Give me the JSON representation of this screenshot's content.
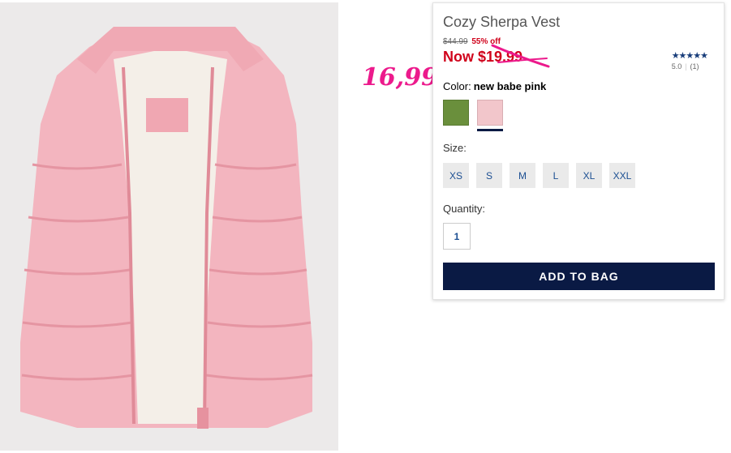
{
  "product": {
    "title": "Cozy Sherpa Vest",
    "original_price": "$44.99",
    "discount": "55% off",
    "now_price": "Now $19.99",
    "annotation_price": "16,99"
  },
  "rating": {
    "stars": "★★★★★",
    "score": "5.0",
    "count": "(1)"
  },
  "color": {
    "label": "Color:",
    "selected": "new babe pink",
    "swatches": [
      "#6a8f3c",
      "#f2c6cb"
    ]
  },
  "size": {
    "label": "Size:",
    "options": [
      "XS",
      "S",
      "M",
      "L",
      "XL",
      "XXL"
    ]
  },
  "quantity": {
    "label": "Quantity:",
    "value": "1"
  },
  "add_to_bag_label": "ADD TO BAG",
  "colors": {
    "sale_red": "#d0021b",
    "navy": "#0a1a44",
    "link_blue": "#1c4f92",
    "annotation_pink": "#ec1a8c"
  }
}
